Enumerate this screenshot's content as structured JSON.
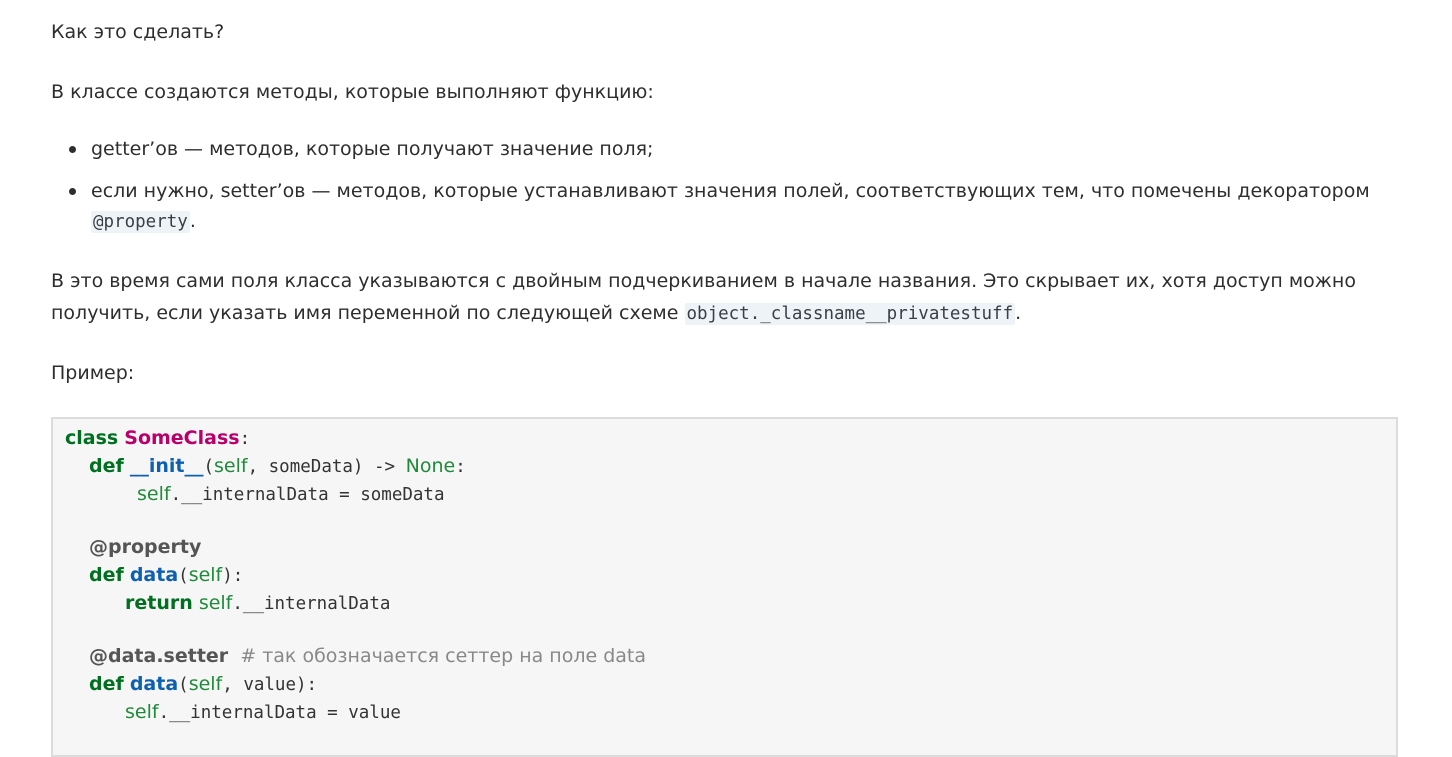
{
  "article": {
    "question": "Как это сделать?",
    "intro": "В классе создаются методы, которые выполняют функцию:",
    "bullets": [
      {
        "text": "getter’ов — методов, которые получают значение поля;"
      },
      {
        "text": "если нужно, setter’ов — методов, которые устанавливают значения полей, соответствующих тем, что помечены декоратором",
        "code": "@property",
        "tail": "."
      }
    ],
    "explanation": {
      "line1": "В это время сами поля класса указываются с двойным подчеркиванием в начале названия. Это скрывает их, хотя доступ можно",
      "line2_prefix": "получить, если указать имя переменной по следующей схеме",
      "code": "object._classname__privatestuff",
      "tail": "."
    },
    "example_label": "Пример:"
  },
  "code": {
    "l1_kw": "class",
    "l1_name": "SomeClass",
    "l1_colon": ":",
    "l2_kw": "def",
    "l2_fn": "__init__",
    "l2_open": "(",
    "l2_self": "self",
    "l2_args": ", someData) -> ",
    "l2_none": "None",
    "l2_colon": ":",
    "l3_self": "self",
    "l3_rest": ".__internalData = someData",
    "l4_dec": "@property",
    "l5_kw": "def",
    "l5_fn": "data",
    "l5_open": "(",
    "l5_self": "self",
    "l5_close": "):",
    "l6_kw": "return",
    "l6_self": "self",
    "l6_rest": ".__internalData",
    "l7_dec": "@data.setter",
    "l7_comment": "# так обозначается сеттер на поле data",
    "l8_kw": "def",
    "l8_fn": "data",
    "l8_open": "(",
    "l8_self": "self",
    "l8_rest": ", value):",
    "l9_self": "self",
    "l9_rest": ".__internalData = value"
  }
}
